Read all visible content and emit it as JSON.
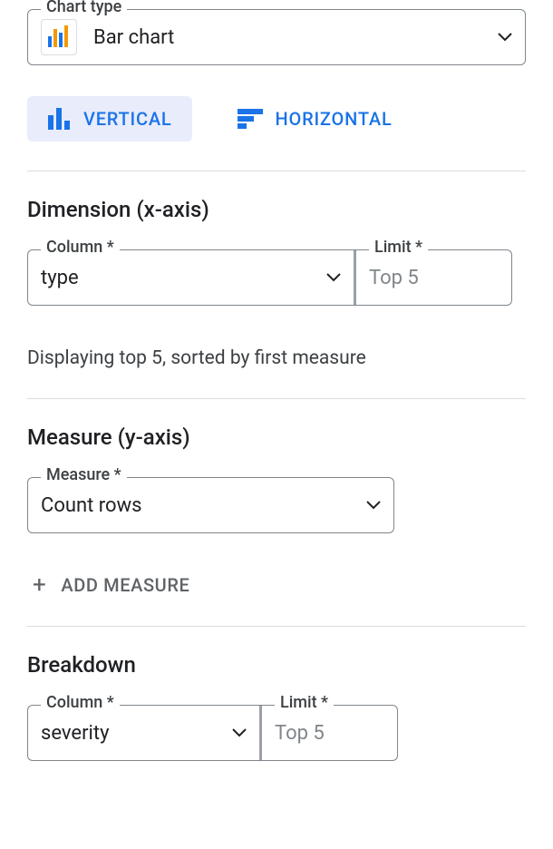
{
  "chart_type": {
    "legend": "Chart type",
    "value": "Bar chart"
  },
  "orientation": {
    "vertical_label": "VERTICAL",
    "horizontal_label": "HORIZONTAL"
  },
  "dimension": {
    "title": "Dimension (x-axis)",
    "column_legend": "Column *",
    "column_value": "type",
    "limit_legend": "Limit *",
    "limit_value": "Top 5",
    "helper": "Displaying top 5, sorted by first measure"
  },
  "measure": {
    "title": "Measure (y-axis)",
    "measure_legend": "Measure *",
    "measure_value": "Count rows",
    "add_label": "ADD MEASURE"
  },
  "breakdown": {
    "title": "Breakdown",
    "column_legend": "Column *",
    "column_value": "severity",
    "limit_legend": "Limit *",
    "limit_value": "Top 5"
  }
}
